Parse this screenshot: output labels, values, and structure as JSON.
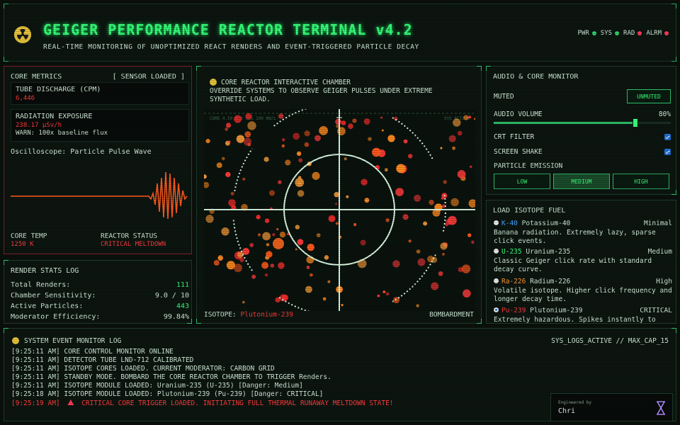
{
  "header": {
    "title": "GEIGER PERFORMANCE REACTOR TERMINAL v4.2",
    "subtitle": "REAL-TIME MONITORING OF UNOPTIMIZED REACT RENDERS AND EVENT-TRIGGERED PARTICLE DECAY",
    "indicators": [
      {
        "label": "PWR",
        "color": "#2fd06a"
      },
      {
        "label": "SYS",
        "color": "#2fd06a"
      },
      {
        "label": "RAD",
        "color": "#ff3b5a"
      },
      {
        "label": "ALRM",
        "color": "#ff3b5a"
      }
    ]
  },
  "core": {
    "title": "CORE METRICS",
    "tag": "[ SENSOR LOADED ]",
    "tube_label": "TUBE DISCHARGE (CPM)",
    "tube_value": "6,446",
    "rad_label": "RADIATION EXPOSURE",
    "rad_value": "238.17 µSv/h",
    "rad_warn": "WARN: 100x baseline flux",
    "osc_label": "Oscilloscope: Particle Pulse Wave",
    "temp_label": "CORE TEMP",
    "temp_value": "1250 K",
    "status_label": "REACTOR STATUS",
    "status_value": "CRITICAL MELTDOWN"
  },
  "stats": {
    "title": "RENDER STATS LOG",
    "rows": [
      {
        "label": "Total Renders:",
        "value": "111"
      },
      {
        "label": "Chamber Sensitivity:",
        "value": "9.0 / 10"
      },
      {
        "label": "Active Particles:",
        "value": "443"
      },
      {
        "label": "Moderator Efficiency:",
        "value": "99.84%"
      }
    ]
  },
  "reactor": {
    "title": "CORE REACTOR INTERACTIVE CHAMBER",
    "desc": "OVERRIDE SYSTEMS TO OBSERVE GEIGER PULSES UNDER EXTREME SYNTHETIC LOAD.",
    "overlay_left": "CORE 4.59 K X SIG 100 KW/L",
    "overlay_right": "SYS ACTIVE",
    "isotope_label": "ISOTOPE:",
    "isotope_value": "Plutonium-239",
    "bombard_label": "BOMBARDMENT"
  },
  "audio": {
    "title": "AUDIO & CORE MONITOR",
    "muted_label": "MUTED",
    "unmuted_button": "UNMUTED",
    "volume_label": "AUDIO VOLUME",
    "volume_value": "80%",
    "volume_fraction": 0.8,
    "crt_label": "CRT FILTER",
    "shake_label": "SCREEN SHAKE",
    "emission_label": "PARTICLE EMISSION",
    "emission_options": [
      "LOW",
      "MEDIUM",
      "HIGH"
    ],
    "emission_selected": "MEDIUM"
  },
  "isotopes": {
    "title": "LOAD ISOTOPE FUEL",
    "items": [
      {
        "code": "K-40",
        "name": "Potassium-40",
        "level": "Minimal",
        "desc": "Banana radiation. Extremely lazy, sparse click events.",
        "color": "#4aa8ff"
      },
      {
        "code": "U-235",
        "name": "Uranium-235",
        "level": "Medium",
        "desc": "Classic Geiger click rate with standard decay curve.",
        "color": "#39ff7a"
      },
      {
        "code": "Ra-226",
        "name": "Radium-226",
        "level": "High",
        "desc": "Volatile isotope. Higher click frequency and longer decay time.",
        "color": "#ff9a2e"
      },
      {
        "code": "Pu-239",
        "name": "Plutonium-239",
        "level": "CRITICAL",
        "desc": "Extremely hazardous. Spikes instantly to",
        "color": "#ff3b3b"
      }
    ]
  },
  "log": {
    "title": "SYSTEM EVENT MONITOR LOG",
    "tag": "SYS_LOGS_ACTIVE // MAX_CAP_15",
    "lines": [
      "[9:25:11 AM] CORE CONTROL MONITOR ONLINE",
      "[9:25:11 AM] DETECTOR TUBE LND-712 CALIBRATED",
      "[9:25:11 AM] ISOTOPE CORES LOADED. CURRENT MODERATOR: CARBON GRID",
      "[9:25:11 AM] STANDBY MODE. BOMBARD THE CORE REACTOR CHAMBER TO TRIGGER Renders.",
      "[9:25:11 AM] ISOTOPE MODULE LOADED: Uranium-235 (U-235) [Danger: Medium]",
      "[9:25:18 AM] ISOTOPE MODULE LOADED: Plutonium-239 (Pu-239) [Danger: CRITICAL]"
    ],
    "critical_time": "[9:25:19 AM]",
    "critical_text": "CRITICAL CORE TRIGGER LOADED. INITIATING FULL THERMAL RUNAWAY MELTDOWN STATE!"
  },
  "engineered": {
    "label": "Engineered by",
    "name": "Chri"
  }
}
